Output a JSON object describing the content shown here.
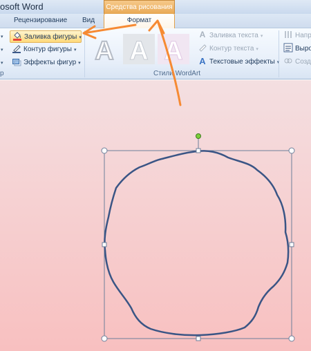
{
  "window": {
    "title": "osoft Word"
  },
  "context_header": {
    "label": "Средства рисования"
  },
  "tabs": {
    "review": "Рецензирование",
    "view": "Вид",
    "format": "Формат"
  },
  "ribbon": {
    "shape_styles": {
      "label": "р",
      "shape_fill": "Заливка фигуры",
      "shape_outline": "Контур фигуры",
      "shape_effects": "Эффекты фигур"
    },
    "wordart_styles": {
      "label": "Стили WordArt",
      "text_fill": "Заливка текста",
      "text_outline": "Контур текста",
      "text_effects": "Текстовые эффекты",
      "thumb_letter": "A"
    },
    "text_group": {
      "direction": "Напр",
      "align": "Выро",
      "create": "Созд"
    }
  },
  "colors": {
    "accent_orange": "#f68a33",
    "shape_outline": "#3a5585",
    "selection_handle": "#ffffff",
    "rotate_handle": "#7dcf3a"
  },
  "icons": [
    "paint-bucket-icon",
    "pen-outline-icon",
    "effects-icon",
    "text-fill-icon",
    "text-outline-icon",
    "text-effects-icon",
    "rotate-handle-icon"
  ]
}
